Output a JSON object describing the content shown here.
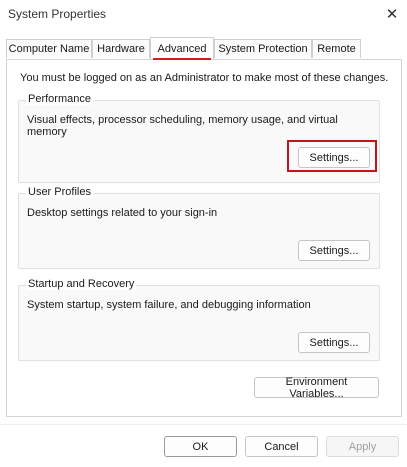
{
  "window": {
    "title": "System Properties",
    "close_glyph": "✕"
  },
  "tabs": [
    {
      "label": "Computer Name",
      "active": false
    },
    {
      "label": "Hardware",
      "active": false
    },
    {
      "label": "Advanced",
      "active": true
    },
    {
      "label": "System Protection",
      "active": false
    },
    {
      "label": "Remote",
      "active": false
    }
  ],
  "advanced": {
    "admin_note": "You must be logged on as an Administrator to make most of these changes.",
    "performance": {
      "title": "Performance",
      "description": "Visual effects, processor scheduling, memory usage, and virtual memory",
      "settings_label": "Settings..."
    },
    "user_profiles": {
      "title": "User Profiles",
      "description": "Desktop settings related to your sign-in",
      "settings_label": "Settings..."
    },
    "startup_recovery": {
      "title": "Startup and Recovery",
      "description": "System startup, system failure, and debugging information",
      "settings_label": "Settings..."
    },
    "environment_variables_label": "Environment Variables..."
  },
  "footer": {
    "ok_label": "OK",
    "cancel_label": "Cancel",
    "apply_label": "Apply"
  },
  "colors": {
    "highlight": "#c0141c",
    "tab_accent": "#d11f1f"
  }
}
